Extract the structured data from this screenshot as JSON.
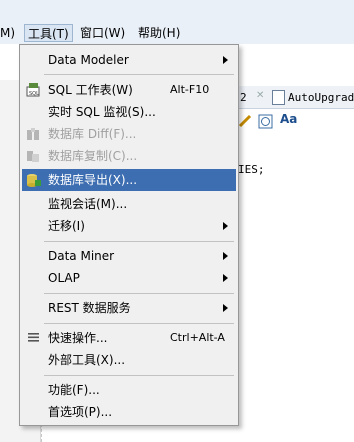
{
  "menubar": {
    "partial_left": "M)",
    "tools": "工具(T)",
    "window": "窗口(W)",
    "help": "帮助(H)"
  },
  "tabs": {
    "partial": "2",
    "autoupgrade": "AutoUpgrad"
  },
  "code_line": "IES;",
  "menu": {
    "data_modeler": "Data Modeler",
    "sql_worksheet": "SQL 工作表(W)",
    "sql_worksheet_shortcut": "Alt-F10",
    "realtime_sql": "实时 SQL 监视(S)...",
    "db_diff": "数据库 Diff(F)...",
    "db_copy": "数据库复制(C)...",
    "db_export": "数据库导出(X)...",
    "monitor_sessions": "监视会话(M)...",
    "migration": "迁移(I)",
    "data_miner": "Data Miner",
    "olap": "OLAP",
    "rest": "REST 数据服务",
    "quick_ops": "快速操作...",
    "quick_ops_shortcut": "Ctrl+Alt-A",
    "external_tools": "外部工具(X)...",
    "features": "功能(F)...",
    "preferences": "首选项(P)..."
  },
  "colors": {
    "highlight": "#3d6eb1",
    "menu_bg": "#f0f0f0",
    "disabled": "#a0a0a0"
  }
}
